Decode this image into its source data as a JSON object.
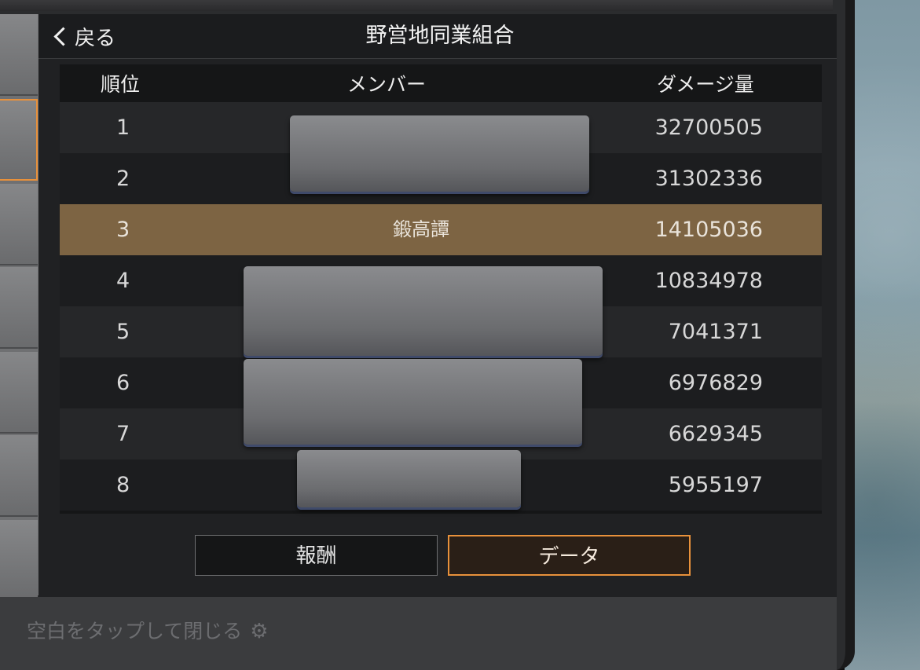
{
  "header": {
    "back_label": "戻る",
    "title": "野営地同業組合"
  },
  "table": {
    "columns": {
      "rank": "順位",
      "member": "メンバー",
      "damage": "ダメージ量"
    },
    "rows": [
      {
        "rank": "1",
        "name": "",
        "damage": "32700505"
      },
      {
        "rank": "2",
        "name": "",
        "damage": "31302336"
      },
      {
        "rank": "3",
        "name": "鍛高譚",
        "damage": "14105036"
      },
      {
        "rank": "4",
        "name": "",
        "damage": "10834978"
      },
      {
        "rank": "5",
        "name": "",
        "damage": "7041371"
      },
      {
        "rank": "6",
        "name": "",
        "damage": "6976829"
      },
      {
        "rank": "7",
        "name": "",
        "damage": "6629345"
      },
      {
        "rank": "8",
        "name": "",
        "damage": "5955197"
      }
    ]
  },
  "tabs": {
    "reward": "報酬",
    "data": "データ"
  },
  "footer": {
    "hint": "空白をタップして閉じる"
  },
  "icons": {
    "back": "chevron-left-icon",
    "settings": "gear-icon"
  },
  "colors": {
    "accent": "#e8913b",
    "highlight_row": "#7d6443"
  }
}
